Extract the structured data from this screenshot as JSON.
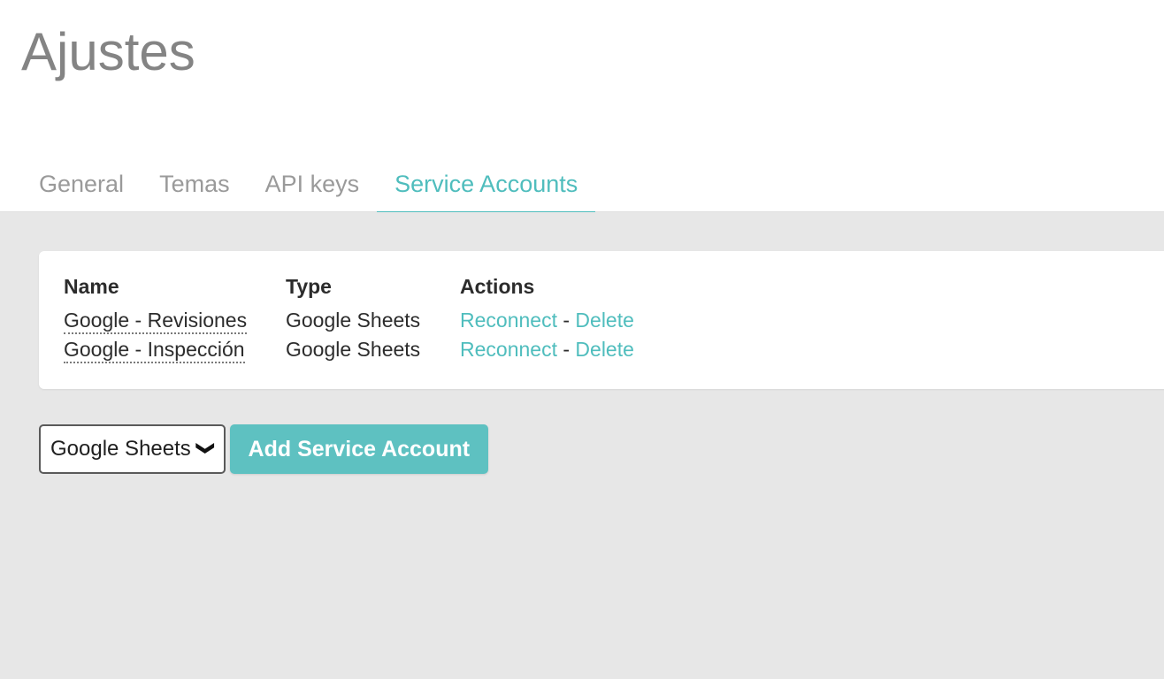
{
  "header": {
    "title": "Ajustes"
  },
  "tabs": [
    {
      "label": "General",
      "active": false
    },
    {
      "label": "Temas",
      "active": false
    },
    {
      "label": "API keys",
      "active": false
    },
    {
      "label": "Service Accounts",
      "active": true
    }
  ],
  "accounts_table": {
    "columns": [
      "Name",
      "Type",
      "Actions"
    ],
    "rows": [
      {
        "name": "Google - Revisiones",
        "type": "Google Sheets",
        "reconnect_label": "Reconnect",
        "separator": "-",
        "delete_label": "Delete"
      },
      {
        "name": "Google - Inspección",
        "type": "Google Sheets",
        "reconnect_label": "Reconnect",
        "separator": "-",
        "delete_label": "Delete"
      }
    ]
  },
  "controls": {
    "service_type_value": "Google Sheets",
    "service_type_options": [
      "Google Sheets"
    ],
    "chevron_icon": "chevron-down-icon",
    "add_button_label": "Add Service Account"
  },
  "colors": {
    "accent": "#4fbdbd",
    "button": "#5ec1c1",
    "title": "#848484",
    "tab_inactive": "#9a9a9a",
    "page_background": "#e7e7e7",
    "card_background": "#ffffff"
  }
}
